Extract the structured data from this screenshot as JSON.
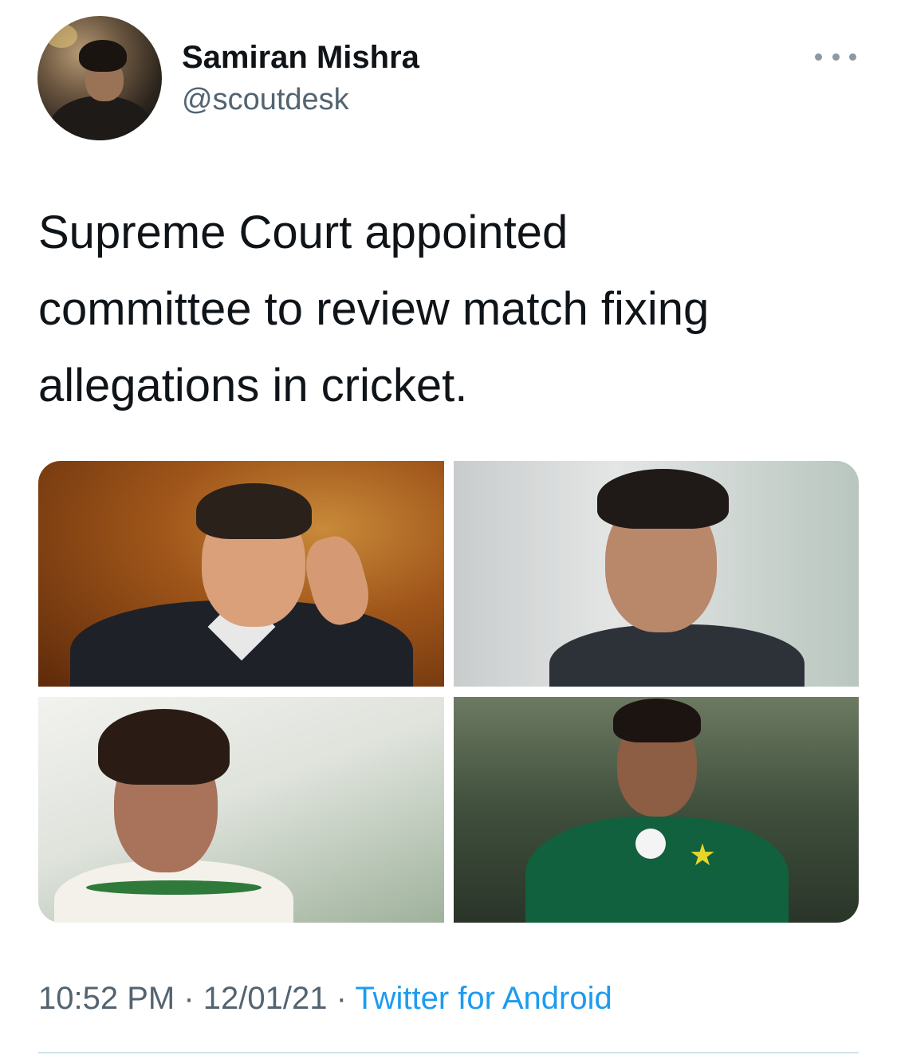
{
  "author": {
    "display_name": "Samiran Mishra",
    "handle": "@scoutdesk"
  },
  "tweet": {
    "text": "Supreme Court appointed\ncommittee to  review match fixing\nallegations in cricket.",
    "media_count": 4
  },
  "meta": {
    "time": "10:52 PM",
    "separator": "·",
    "date": "12/01/21",
    "source": "Twitter for Android"
  },
  "icons": {
    "more": "more-horizontal-icon"
  },
  "colors": {
    "secondary_text": "#536471",
    "link": "#1d9bf0",
    "primary_text": "#0f1419"
  }
}
